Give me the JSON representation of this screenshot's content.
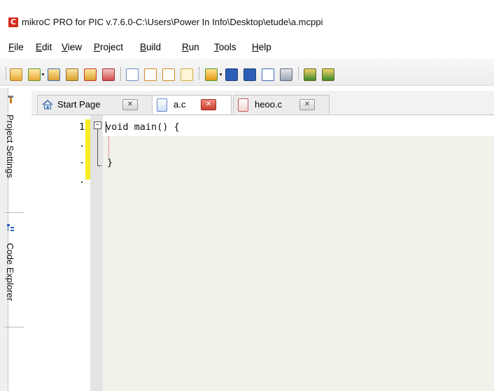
{
  "window": {
    "title": "mikroC PRO for PIC v.7.6.0-C:\\Users\\Power In Info\\Desktop\\etude\\a.mcppi",
    "app_icon_letter": "C",
    "accent_color": "#d52a1e"
  },
  "menu": {
    "items": [
      "File",
      "Edit",
      "View",
      "Project",
      "Build",
      "Run",
      "Tools",
      "Help"
    ]
  },
  "toolbar": {
    "icons": [
      "new-project-icon",
      "open-project-icon",
      "save-project-icon",
      "edit-project-icon",
      "close-project-icon",
      "project-settings-icon",
      "new-file-icon",
      "open-file-icon",
      "add-file-icon",
      "remove-file-icon",
      "open-icon",
      "save-icon",
      "save-all-icon",
      "print-preview-icon",
      "print-icon",
      "build-icon",
      "build-all-icon"
    ]
  },
  "left_panel": {
    "tabs": [
      {
        "label": "Project Settings",
        "icon": "tools-icon"
      },
      {
        "label": "Code Explorer",
        "icon": "tree-icon"
      }
    ]
  },
  "tabs": [
    {
      "label": "Start Page",
      "icon": "home-icon",
      "active": false
    },
    {
      "label": "a.c",
      "icon": "c-file-icon",
      "active": true
    },
    {
      "label": "heoo.c",
      "icon": "c-file-icon",
      "active": false
    }
  ],
  "editor": {
    "line_numbers": [
      "1",
      ".",
      ".",
      "."
    ],
    "code_lines": [
      "void main() {",
      "",
      "}"
    ],
    "modified_bar_color": "#f6ec1f"
  }
}
